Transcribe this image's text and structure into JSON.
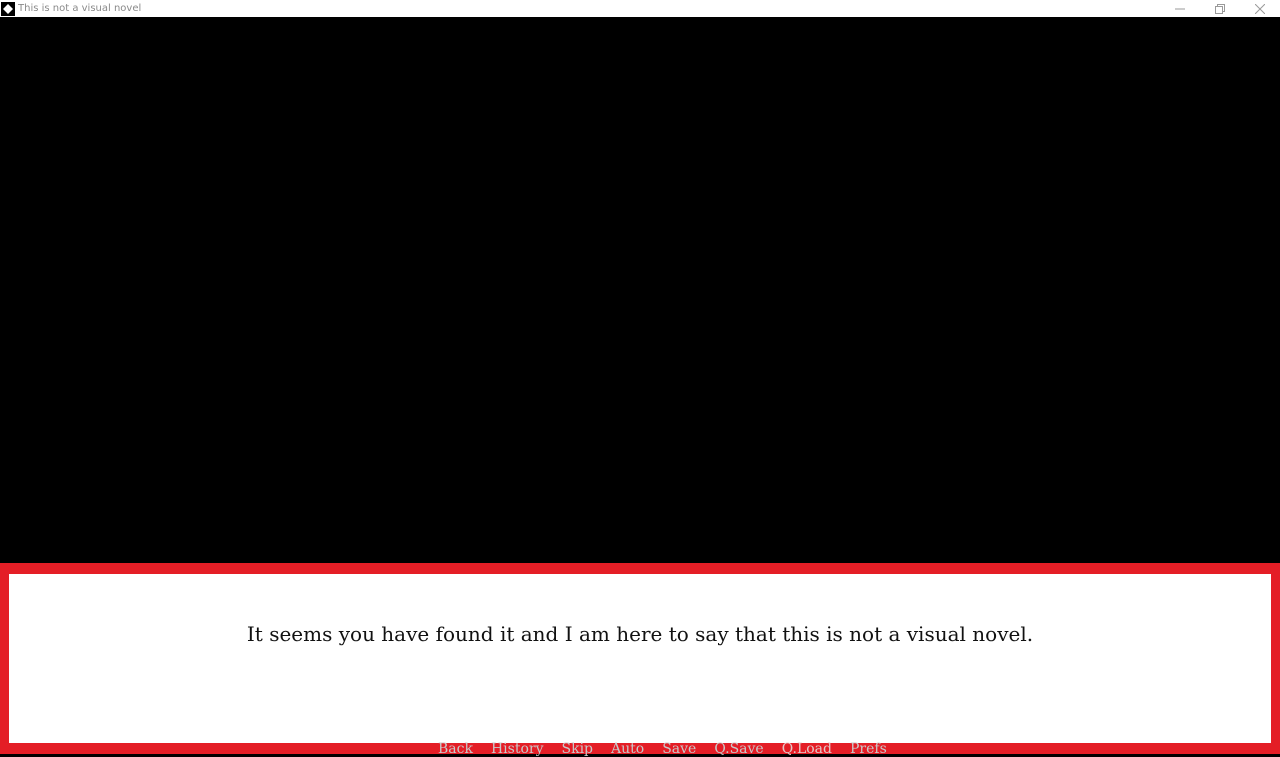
{
  "window": {
    "title": "This is not a visual novel",
    "controls": [
      "minimize-icon",
      "restore-icon",
      "close-icon"
    ]
  },
  "colors": {
    "frame": "#e41e26",
    "background": "#000000",
    "textbox": "#ffffff"
  },
  "dialogue": {
    "text": "It seems you have found it and I am here to say that this is not a visual novel."
  },
  "quick_menu": {
    "items": [
      "Back",
      "History",
      "Skip",
      "Auto",
      "Save",
      "Q.Save",
      "Q.Load",
      "Prefs"
    ]
  }
}
